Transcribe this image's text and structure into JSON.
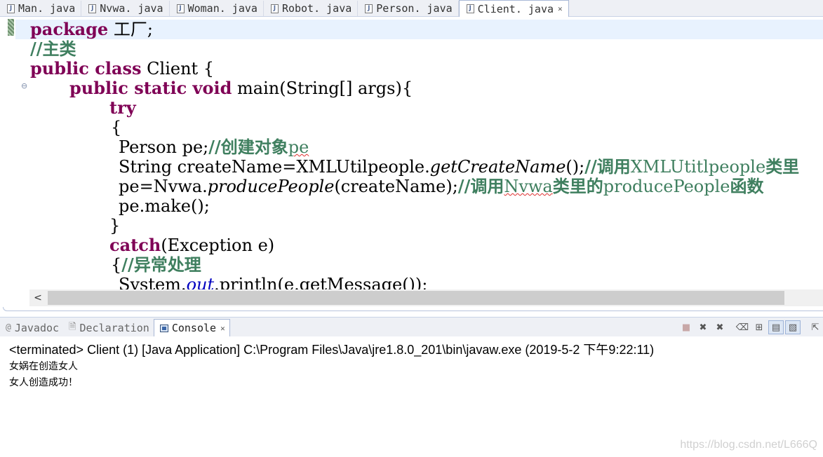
{
  "editor_tabs": [
    {
      "label": "Man. java",
      "active": false
    },
    {
      "label": "Nvwa. java",
      "active": false
    },
    {
      "label": "Woman. java",
      "active": false
    },
    {
      "label": "Robot. java",
      "active": false
    },
    {
      "label": "Person. java",
      "active": false
    },
    {
      "label": "Client. java",
      "active": true
    }
  ],
  "code": {
    "l1_kw": "package",
    "l1_rest": " 工厂;",
    "l2_comment": "//主类",
    "l3_kw": "public class",
    "l3_rest": " Client {",
    "l4_kw": "public static void",
    "l4_rest": " main(String[] args){",
    "l5_kw": "try",
    "l6": "{",
    "l7_code": "Person pe;",
    "l7_comment": "//创建对象",
    "l7_comment_en": "pe",
    "l8_code": "String createName=XMLUtilpeople.",
    "l8_method": "getCreateName",
    "l8_code2": "();",
    "l8_comment": "//调用",
    "l8_comment_en": "XMLUtitlpeople",
    "l8_comment2": "类里",
    "l9_code": "pe=Nvwa.",
    "l9_method": "producePeople",
    "l9_code2": "(createName);",
    "l9_comment": "//调用",
    "l9_comment_en": "Nvwa",
    "l9_comment2": "类里的",
    "l9_comment_en2": "producePeople",
    "l9_comment3": "函数",
    "l10": "pe.make();",
    "l11": "}",
    "l12_kw": "catch",
    "l12_rest": "(Exception e)",
    "l13_code": "{",
    "l13_comment": "//异常处理",
    "l14_code": "System.",
    "l14_field": "out",
    "l14_code2": ".println(e.getMessage());"
  },
  "panel_tabs": [
    {
      "label": "Javadoc",
      "icon": "at-icon",
      "active": false
    },
    {
      "label": "Declaration",
      "icon": "declaration-icon",
      "active": false
    },
    {
      "label": "Console",
      "icon": "console-icon",
      "active": true
    }
  ],
  "console": {
    "status": "<terminated> Client (1) [Java Application] C:\\Program Files\\Java\\jre1.8.0_201\\bin\\javaw.exe (2019-5-2 下午9:22:11)",
    "output": [
      "女娲在创造女人",
      "女人创造成功！"
    ]
  },
  "watermark": "https://blog.csdn.net/L666Q"
}
